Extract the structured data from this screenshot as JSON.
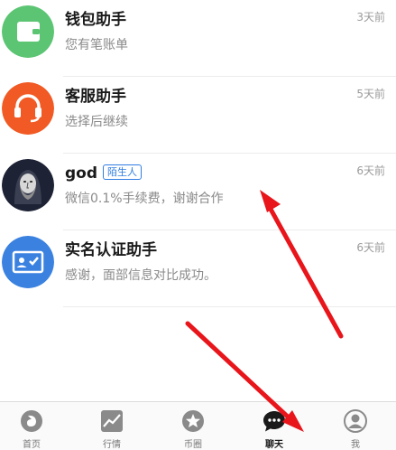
{
  "chats": [
    {
      "name": "钱包助手",
      "preview": "您有笔账单",
      "time": "3天前",
      "icon": "wallet-icon",
      "color": "#5cc573"
    },
    {
      "name": "客服助手",
      "preview": "选择后继续",
      "time": "5天前",
      "icon": "headset-icon",
      "color": "#f15a24"
    },
    {
      "name": "god",
      "badge": "陌生人",
      "preview": "微信0.1%手续费，谢谢合作",
      "time": "6天前",
      "icon": "user-avatar",
      "color": "#1d2235"
    },
    {
      "name": "实名认证助手",
      "preview": "感谢，面部信息对比成功。",
      "time": "6天前",
      "icon": "id-card-icon",
      "color": "#3b82e0"
    }
  ],
  "tabs": [
    {
      "label": "首页",
      "icon": "home-icon"
    },
    {
      "label": "行情",
      "icon": "chart-icon"
    },
    {
      "label": "币圈",
      "icon": "star-icon"
    },
    {
      "label": "聊天",
      "icon": "chat-icon",
      "active": true
    },
    {
      "label": "我",
      "icon": "profile-icon"
    }
  ],
  "colors": {
    "accent": "#2f7de1",
    "arrow": "#e8151b"
  }
}
